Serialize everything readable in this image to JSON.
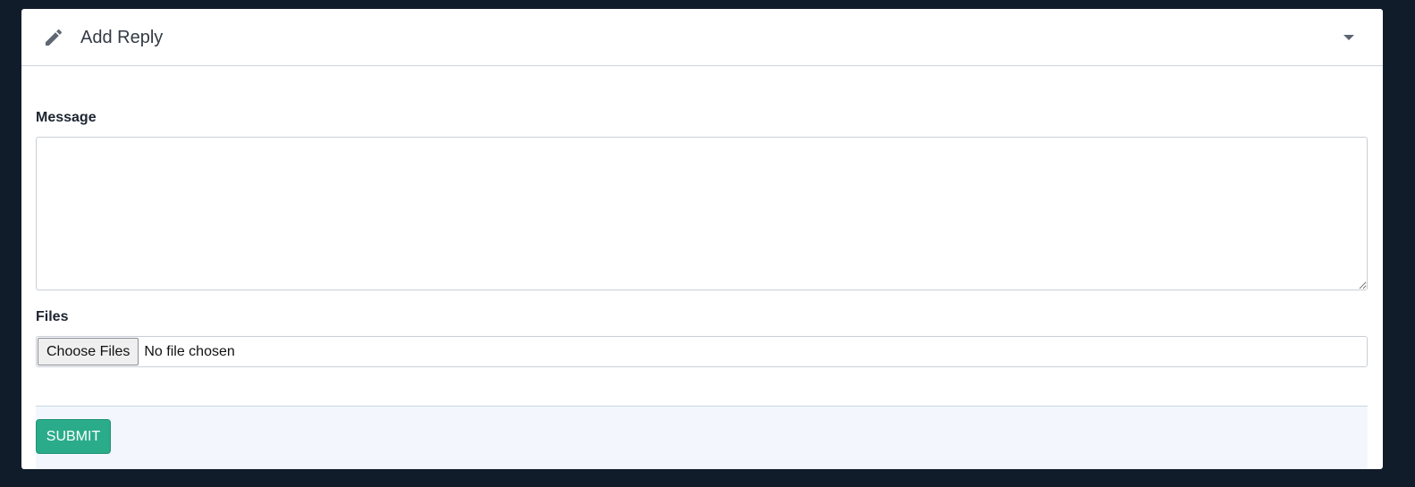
{
  "header": {
    "title": "Add Reply",
    "icon": "pencil-icon",
    "toggle_icon": "caret-down-icon"
  },
  "form": {
    "message_label": "Message",
    "message_value": "",
    "files_label": "Files",
    "file_button_label": "Choose Files",
    "file_status": "No file chosen"
  },
  "footer": {
    "submit_label": "SUBMIT"
  },
  "colors": {
    "page_background": "#111c2b",
    "submit_button": "#2aac8a",
    "footer_background": "#f3f7fd"
  }
}
